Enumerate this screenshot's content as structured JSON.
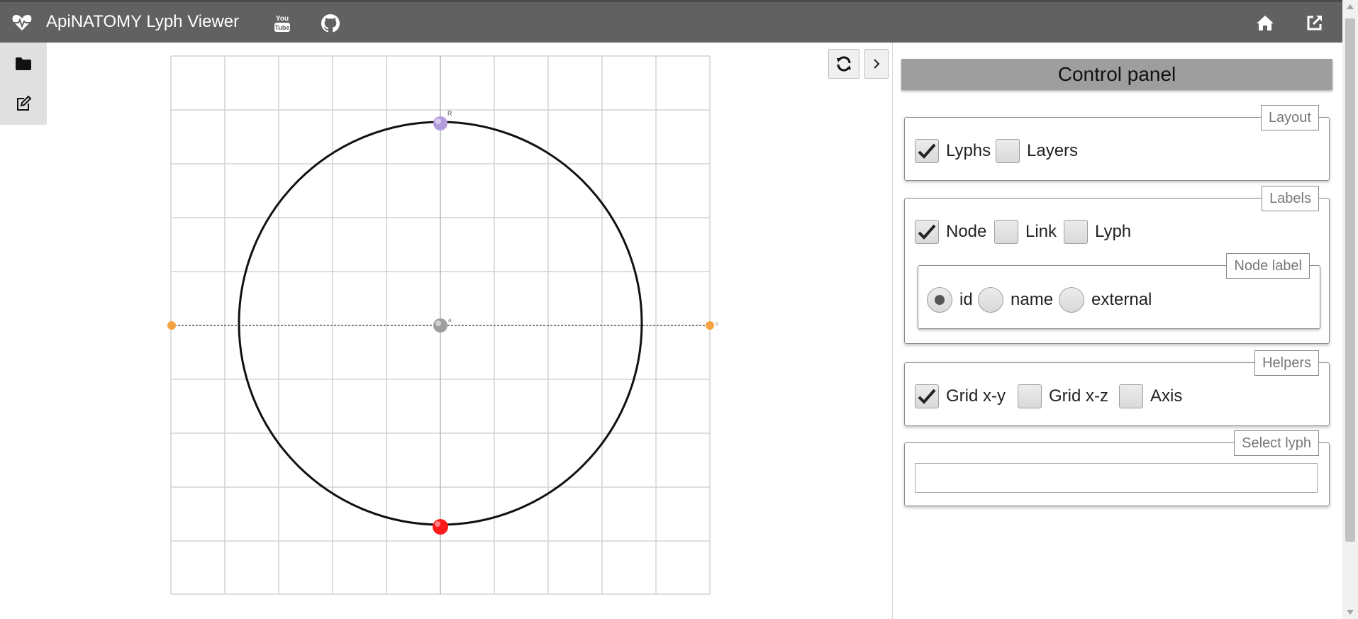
{
  "header": {
    "title": "ApiNATOMY Lyph Viewer",
    "brand_icon": "heartbeat-icon",
    "youtube_icon": "youtube-icon",
    "github_icon": "github-icon",
    "home_icon": "home-icon",
    "external_icon": "external-link-icon"
  },
  "toolbar": {
    "open_icon": "folder-icon",
    "edit_icon": "edit-icon",
    "refresh_icon": "refresh-icon",
    "collapse_icon": "chevron-right-icon"
  },
  "scene": {
    "node_labels": {
      "top": "R",
      "center": "a",
      "right": "c"
    },
    "colors": {
      "grid": "#d0d0d0",
      "circle": "#111111",
      "top_node": "#b39ddb",
      "bottom_node": "#ff1a1a",
      "center_node": "#9e9e9e",
      "axis_nodes": "#f5a340"
    }
  },
  "panel": {
    "title": "Control panel",
    "layout": {
      "legend": "Layout",
      "options": [
        {
          "label": "Lyphs",
          "checked": true
        },
        {
          "label": "Layers",
          "checked": false
        }
      ]
    },
    "labels": {
      "legend": "Labels",
      "options": [
        {
          "label": "Node",
          "checked": true
        },
        {
          "label": "Link",
          "checked": false
        },
        {
          "label": "Lyph",
          "checked": false
        }
      ],
      "node_label": {
        "legend": "Node label",
        "options": [
          {
            "label": "id",
            "selected": true
          },
          {
            "label": "name",
            "selected": false
          },
          {
            "label": "external",
            "selected": false
          }
        ]
      }
    },
    "helpers": {
      "legend": "Helpers",
      "options": [
        {
          "label": "Grid x-y",
          "checked": true
        },
        {
          "label": "Grid x-z",
          "checked": false
        },
        {
          "label": "Axis",
          "checked": false
        }
      ]
    },
    "select_lyph": {
      "legend": "Select lyph",
      "value": "",
      "placeholder": ""
    }
  }
}
